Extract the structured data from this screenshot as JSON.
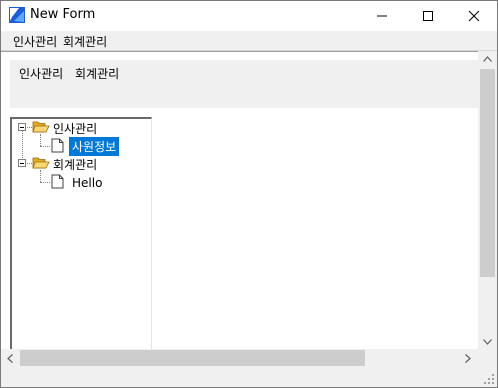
{
  "window": {
    "title": "New Form"
  },
  "menubar": {
    "items": [
      {
        "label": "인사관리"
      },
      {
        "label": "회계관리"
      }
    ]
  },
  "toolbar": {
    "items": [
      {
        "label": "인사관리"
      },
      {
        "label": "회계관리"
      }
    ]
  },
  "tree": {
    "nodes": [
      {
        "label": "인사관리",
        "expanded": true,
        "children": [
          {
            "label": "사원정보",
            "selected": true
          }
        ]
      },
      {
        "label": "회계관리",
        "expanded": true,
        "children": [
          {
            "label": "Hello"
          }
        ]
      }
    ]
  },
  "icons": {
    "app": "app-icon",
    "folder": "folder-open-icon",
    "document": "document-icon"
  },
  "colors": {
    "selection": "#0078d7",
    "folder": "#f2c55c"
  }
}
